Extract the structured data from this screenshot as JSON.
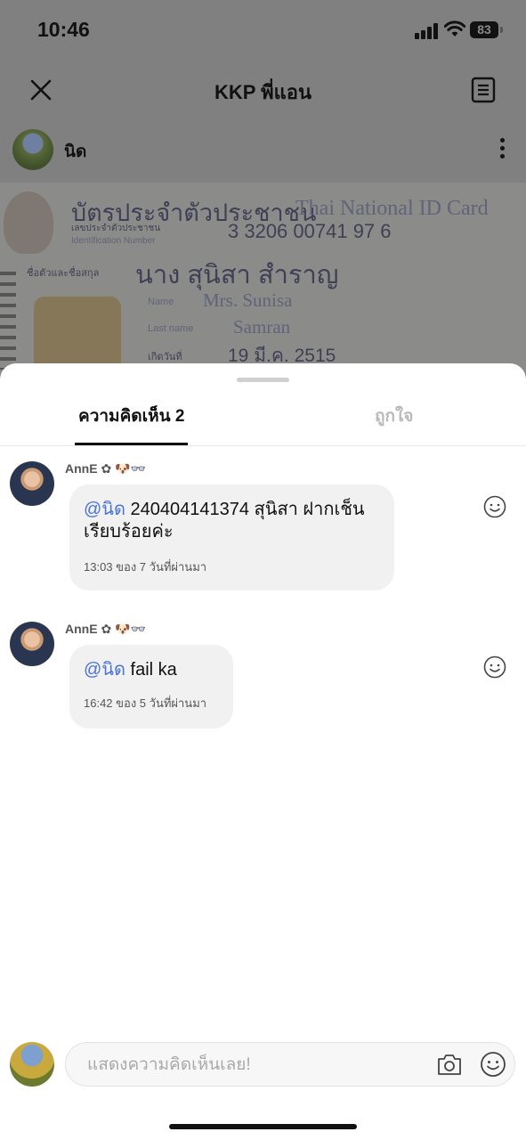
{
  "status_bar": {
    "time": "10:46",
    "battery": "83"
  },
  "header": {
    "title": "KKP พี่แอน"
  },
  "post": {
    "author": "นิด",
    "card": {
      "title_th": "บัตรประจำตัวประชาชน",
      "title_en": "Thai National ID Card",
      "id_label_th": "เลขประจำตัวประชาชน",
      "id_label_en": "Identification Number",
      "id_number": "3 3206 00741 97 6",
      "name_label_th": "ชื่อตัวและชื่อสกุล",
      "name_th": "นาง สุนิสา สำราญ",
      "name_label_en": "Name",
      "name_en": "Mrs. Sunisa",
      "lastname_label_en": "Last name",
      "lastname_en": "Samran",
      "dob_label_th": "เกิดวันที่",
      "dob_th": "19 มี.ค. 2515"
    }
  },
  "sheet": {
    "tabs": {
      "comments": "ความคิดเห็น 2",
      "likes": "ถูกใจ"
    },
    "comments": [
      {
        "author": "AnnE ✿ 🐶👓",
        "mention": "@นิด",
        "text": " 240404141374 สุนิสา ฝากเช็นเรียบร้อยค่ะ",
        "meta": "13:03 ของ 7 วันที่ผ่านมา"
      },
      {
        "author": "AnnE ✿ 🐶👓",
        "mention": "@นิด",
        "text": " fail ka",
        "meta": "16:42 ของ 5 วันที่ผ่านมา"
      }
    ],
    "input": {
      "placeholder": "แสดงความคิดเห็นเลย!"
    }
  },
  "icons": [
    "close-icon",
    "notes-icon",
    "more-icon",
    "smile-icon",
    "camera-icon",
    "emoji-icon"
  ]
}
